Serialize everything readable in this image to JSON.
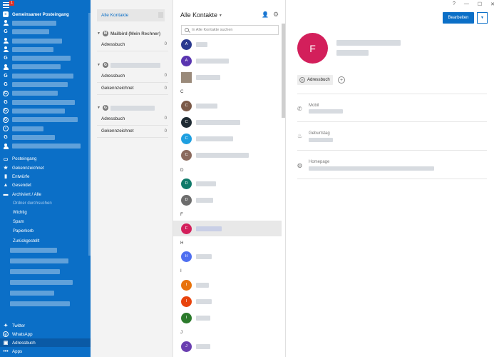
{
  "sidebar": {
    "inbox_badge": "1",
    "shared_inbox": "Gemeinsamer Posteingang",
    "folders": [
      {
        "label": "Posteingang",
        "icon": "inbox-icon"
      },
      {
        "label": "Gekennzeichnet",
        "icon": "star-icon"
      },
      {
        "label": "Entwürfe",
        "icon": "drafts-icon"
      },
      {
        "label": "Gesendet",
        "icon": "sent-icon"
      },
      {
        "label": "Archiviert / Alle",
        "icon": "archive-icon"
      }
    ],
    "search_folders": "Ordner durchsuchen",
    "subfolders": [
      "Wichtig",
      "Spam",
      "Papierkorb",
      "Zurückgestellt"
    ],
    "apps": [
      {
        "label": "Twitter",
        "icon": "twitter-icon"
      },
      {
        "label": "WhatsApp",
        "icon": "whatsapp-icon"
      },
      {
        "label": "Adressbuch",
        "icon": "addressbook-icon"
      },
      {
        "label": "Apps",
        "icon": "apps-icon"
      }
    ]
  },
  "books": {
    "all_contacts": "Alle Kontakte",
    "mailbird_header": "Mailbird (Mein Rechner)",
    "groups": [
      {
        "items": [
          {
            "label": "Adressbuch",
            "count": "0"
          }
        ]
      },
      {
        "items": [
          {
            "label": "Adressbuch",
            "count": "0"
          },
          {
            "label": "Gekennzeichnet",
            "count": "0"
          }
        ]
      },
      {
        "items": [
          {
            "label": "Adressbuch",
            "count": "0"
          },
          {
            "label": "Gekennzeichnet",
            "count": "0"
          }
        ]
      }
    ]
  },
  "list": {
    "title": "Alle Kontakte",
    "search_placeholder": "In Alle Kontakte suchen",
    "sections": [
      "C",
      "D",
      "F",
      "H",
      "I",
      "J"
    ],
    "avatars": {
      "a1": "A",
      "a2": "A",
      "c1": "C",
      "c2": "C",
      "c3": "C",
      "c4": "C",
      "d1": "D",
      "d2": "D",
      "f1": "F",
      "h1": "H",
      "i1": "I",
      "i2": "I",
      "i3": "I",
      "j1": "J"
    },
    "colors": {
      "a1": "#2a3a8f",
      "a2": "#5a35b0",
      "c1": "#7b5a48",
      "c2": "#1f2b33",
      "c3": "#1e9fe0",
      "c4": "#8a6a5d",
      "d1": "#0f7a6a",
      "d2": "#6d6d6d",
      "f1": "#d31f5b",
      "h1": "#4f6ff0",
      "i1": "#e8730c",
      "i2": "#e8430c",
      "i3": "#2b7a2b",
      "j1": "#6a3fb0"
    }
  },
  "detail": {
    "edit_label": "Bearbeiten",
    "avatar_letter": "F",
    "tag_label": "Adressbuch",
    "mobile_label": "Mobil",
    "birthday_label": "Geburtstag",
    "homepage_label": "Homepage"
  }
}
